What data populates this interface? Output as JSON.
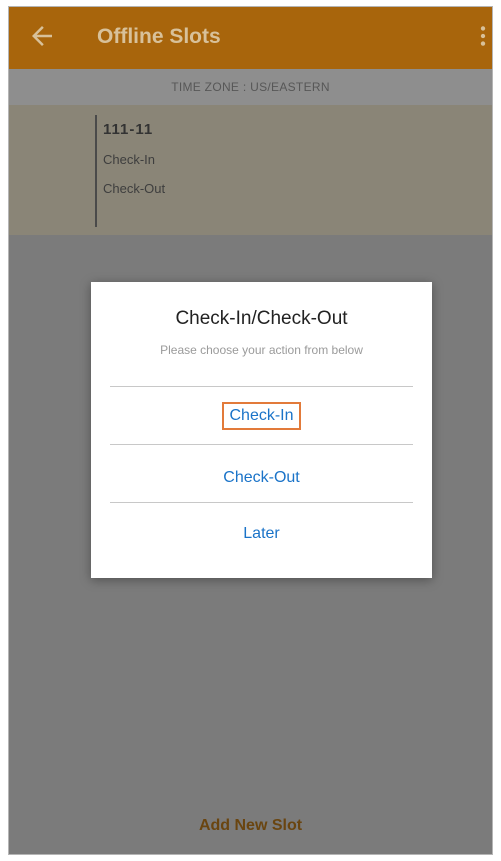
{
  "appbar": {
    "title": "Offline Slots",
    "back_icon": "back-arrow-icon",
    "more_icon": "more-vert-icon",
    "color": "#a8650c"
  },
  "timezone": {
    "label": "TIME ZONE : US/EASTERN"
  },
  "slot": {
    "id": "111-11",
    "check_in": "Check-In",
    "check_out": "Check-Out"
  },
  "dialog": {
    "title": "Check-In/Check-Out",
    "subtitle": "Please choose your action from below",
    "actions": {
      "check_in": "Check-In",
      "check_out": "Check-Out",
      "later": "Later"
    },
    "action_color": "#1a73c8",
    "focus_color": "#e27a3a"
  },
  "footer": {
    "add_new_slot": "Add New Slot"
  }
}
